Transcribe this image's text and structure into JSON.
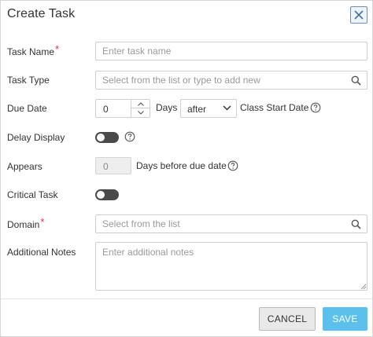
{
  "dialog": {
    "title": "Create Task",
    "close_icon": "close-icon"
  },
  "fields": {
    "task_name": {
      "label": "Task Name",
      "required_marker": "*",
      "placeholder": "Enter task name",
      "value": ""
    },
    "task_type": {
      "label": "Task Type",
      "placeholder": "Select from the list or type to add new",
      "value": "",
      "icon": "search-icon"
    },
    "due_date": {
      "label": "Due Date",
      "days_value": "0",
      "days_unit": "Days",
      "relation_selected": "after",
      "anchor_text": "Class Start Date",
      "help_icon": "help-icon"
    },
    "delay_display": {
      "label": "Delay Display",
      "enabled": false,
      "help_icon": "help-icon"
    },
    "appears": {
      "label": "Appears",
      "value": "0",
      "suffix": "Days before due date",
      "disabled": true,
      "help_icon": "help-icon"
    },
    "critical_task": {
      "label": "Critical Task",
      "enabled": false
    },
    "domain": {
      "label": "Domain",
      "required_marker": "*",
      "placeholder": "Select from the list",
      "value": "",
      "icon": "search-icon"
    },
    "additional_notes": {
      "label": "Additional Notes",
      "placeholder": "Enter additional notes",
      "value": ""
    }
  },
  "footer": {
    "cancel_label": "CANCEL",
    "save_label": "SAVE"
  },
  "colors": {
    "required": "#d9363e",
    "save_button": "#5bc0ec",
    "toggle_off": "#4a4a4a",
    "close_border": "#6f8fb5"
  }
}
